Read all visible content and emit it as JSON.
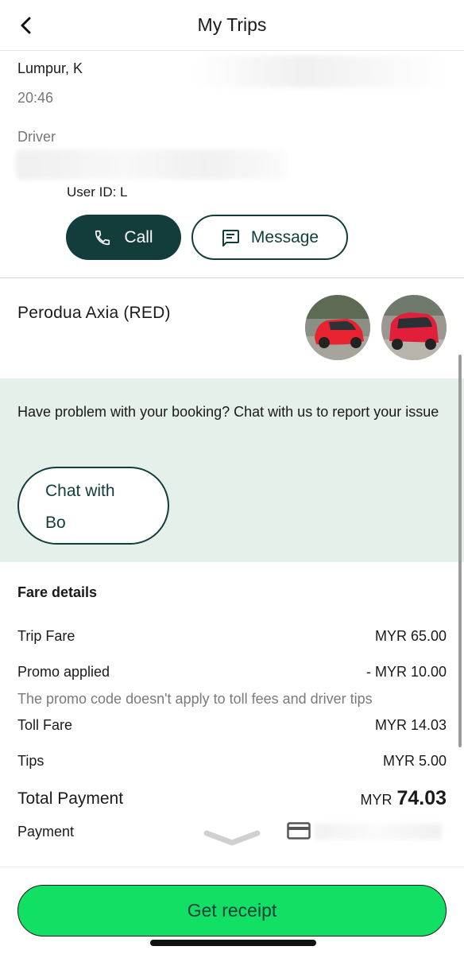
{
  "header": {
    "title": "My Trips",
    "back_icon": "chevron-left-icon"
  },
  "trip": {
    "address_partial": "Lumpur, K",
    "time": "20:46"
  },
  "driver": {
    "label": "Driver",
    "user_id": "User ID: L",
    "call_label": "Call",
    "message_label": "Message"
  },
  "vehicle": {
    "name": "Perodua Axia (RED)"
  },
  "help": {
    "text": "Have problem with your booking? Chat with us to report your issue",
    "chat_label_line1": "Chat with",
    "chat_label_line2": "Bo"
  },
  "fare": {
    "title": "Fare details",
    "trip_fare_label": "Trip Fare",
    "trip_fare_value": "MYR 65.00",
    "promo_label": "Promo applied",
    "promo_value": "- MYR 10.00",
    "promo_note": "The promo code doesn't apply to toll fees and driver tips",
    "toll_label": "Toll Fare",
    "toll_value": "MYR 14.03",
    "tips_label": "Tips",
    "tips_value": "MYR 5.00",
    "total_label": "Total Payment",
    "total_currency": "MYR",
    "total_amount": "74.03",
    "payment_label": "Payment"
  },
  "actions": {
    "receipt_label": "Get receipt"
  },
  "colors": {
    "primary_dark": "#123d3a",
    "accent_green": "#11e064",
    "help_bg": "#e6f0ea"
  }
}
